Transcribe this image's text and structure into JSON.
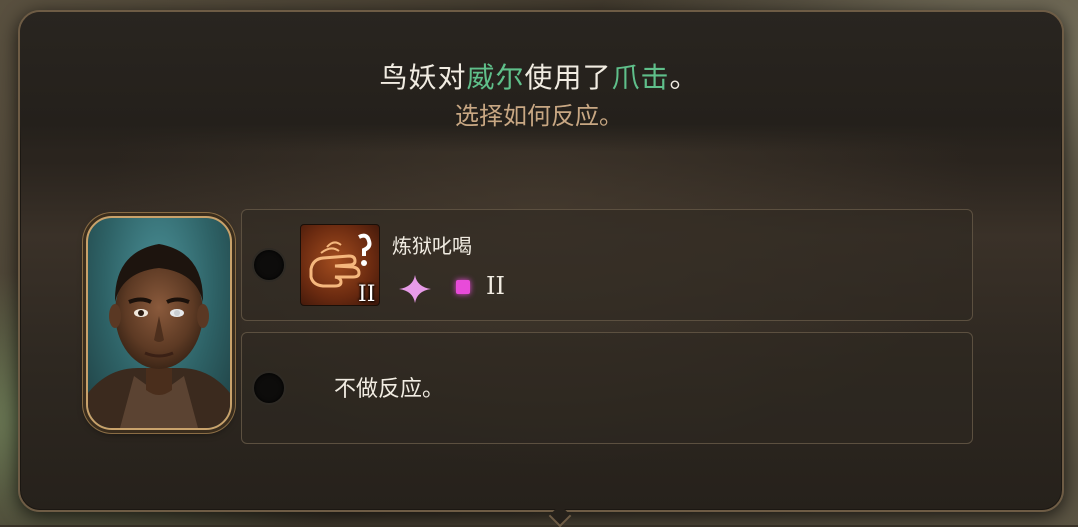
{
  "prompt": {
    "attacker": "鸟妖",
    "verb_to": "对",
    "target": "威尔",
    "verb_used": "使用了",
    "attack": "爪击",
    "end": "。",
    "subtitle": "选择如何反应。",
    "highlight_color": "#5fbf8a"
  },
  "portrait": {
    "icon": "character-portrait-wyll"
  },
  "options": [
    {
      "name": "炼狱叱喝",
      "spell_level": "II",
      "spell_icon": "hellish-rebuke-hand-icon",
      "cost_icon": "action-spark-icon",
      "slot_icon": "spell-slot-icon",
      "slot_level": "II",
      "slot_color": "#e84bd9"
    },
    {
      "label": "不做反应。"
    }
  ]
}
